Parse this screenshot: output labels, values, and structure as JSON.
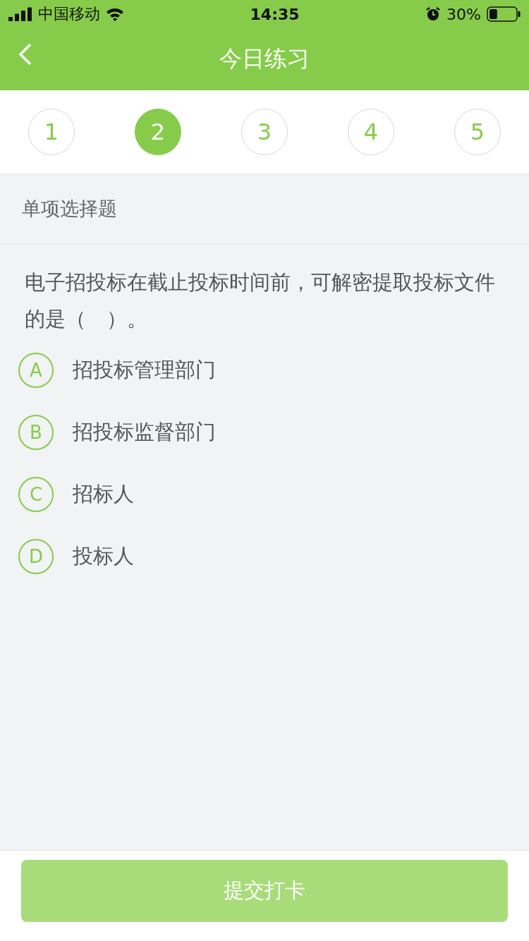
{
  "status_bar": {
    "carrier": "中国移动",
    "time": "14:35",
    "battery": "30%"
  },
  "nav": {
    "title": "今日练习"
  },
  "steps": [
    {
      "label": "1",
      "selected": false
    },
    {
      "label": "2",
      "selected": true
    },
    {
      "label": "3",
      "selected": false
    },
    {
      "label": "4",
      "selected": false
    },
    {
      "label": "5",
      "selected": false
    }
  ],
  "section": {
    "title": "单项选择题"
  },
  "question": "电子招投标在截止投标时间前，可解密提取投标文件的是（　）。",
  "options": [
    {
      "letter": "A",
      "text": "招投标管理部门",
      "selected": false
    },
    {
      "letter": "B",
      "text": "招投标监督部门",
      "selected": false
    },
    {
      "letter": "C",
      "text": "招标人",
      "selected": false
    },
    {
      "letter": "D",
      "text": "投标人",
      "selected": false
    }
  ],
  "submit": {
    "label": "提交打卡",
    "disabled": true
  }
}
